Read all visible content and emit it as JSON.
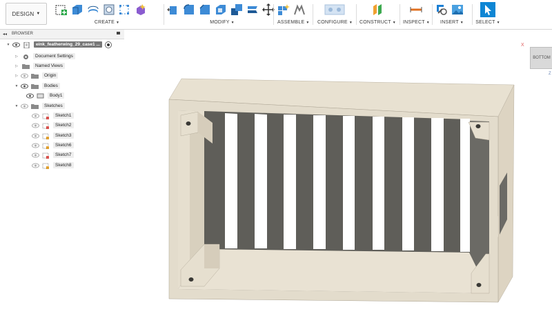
{
  "toolbar": {
    "design_label": "DESIGN",
    "groups": [
      {
        "label": "CREATE"
      },
      {
        "label": "MODIFY"
      },
      {
        "label": "ASSEMBLE"
      },
      {
        "label": "CONFIGURE"
      },
      {
        "label": "CONSTRUCT"
      },
      {
        "label": "INSPECT"
      },
      {
        "label": "INSERT"
      },
      {
        "label": "SELECT"
      }
    ]
  },
  "browser": {
    "title": "BROWSER",
    "items": [
      {
        "label": "eink_featherwing_29_case1 ...",
        "icon": "document-icon"
      },
      {
        "label": "Document Settings",
        "icon": "gear-icon"
      },
      {
        "label": "Named Views",
        "icon": "folder-icon"
      },
      {
        "label": "Origin",
        "icon": "folder-icon"
      },
      {
        "label": "Bodies",
        "icon": "folder-icon"
      },
      {
        "label": "Body1",
        "icon": "body-icon"
      },
      {
        "label": "Sketches",
        "icon": "folder-icon"
      },
      {
        "label": "Sketch1",
        "icon": "sketch-icon"
      },
      {
        "label": "Sketch2",
        "icon": "sketch-icon"
      },
      {
        "label": "Sketch3",
        "icon": "sketch-icon"
      },
      {
        "label": "Sketch6",
        "icon": "sketch-icon"
      },
      {
        "label": "Sketch7",
        "icon": "sketch-icon"
      },
      {
        "label": "Sketch8",
        "icon": "sketch-icon"
      }
    ]
  },
  "viewcube": {
    "face": "BOTTOM",
    "x_axis": "X",
    "z_axis": "Z"
  },
  "colors": {
    "accent": "#1b7fd4",
    "selected_bg": "#0e86d4",
    "model_face": "#e8e1d1",
    "model_wall": "#6b6a65"
  }
}
